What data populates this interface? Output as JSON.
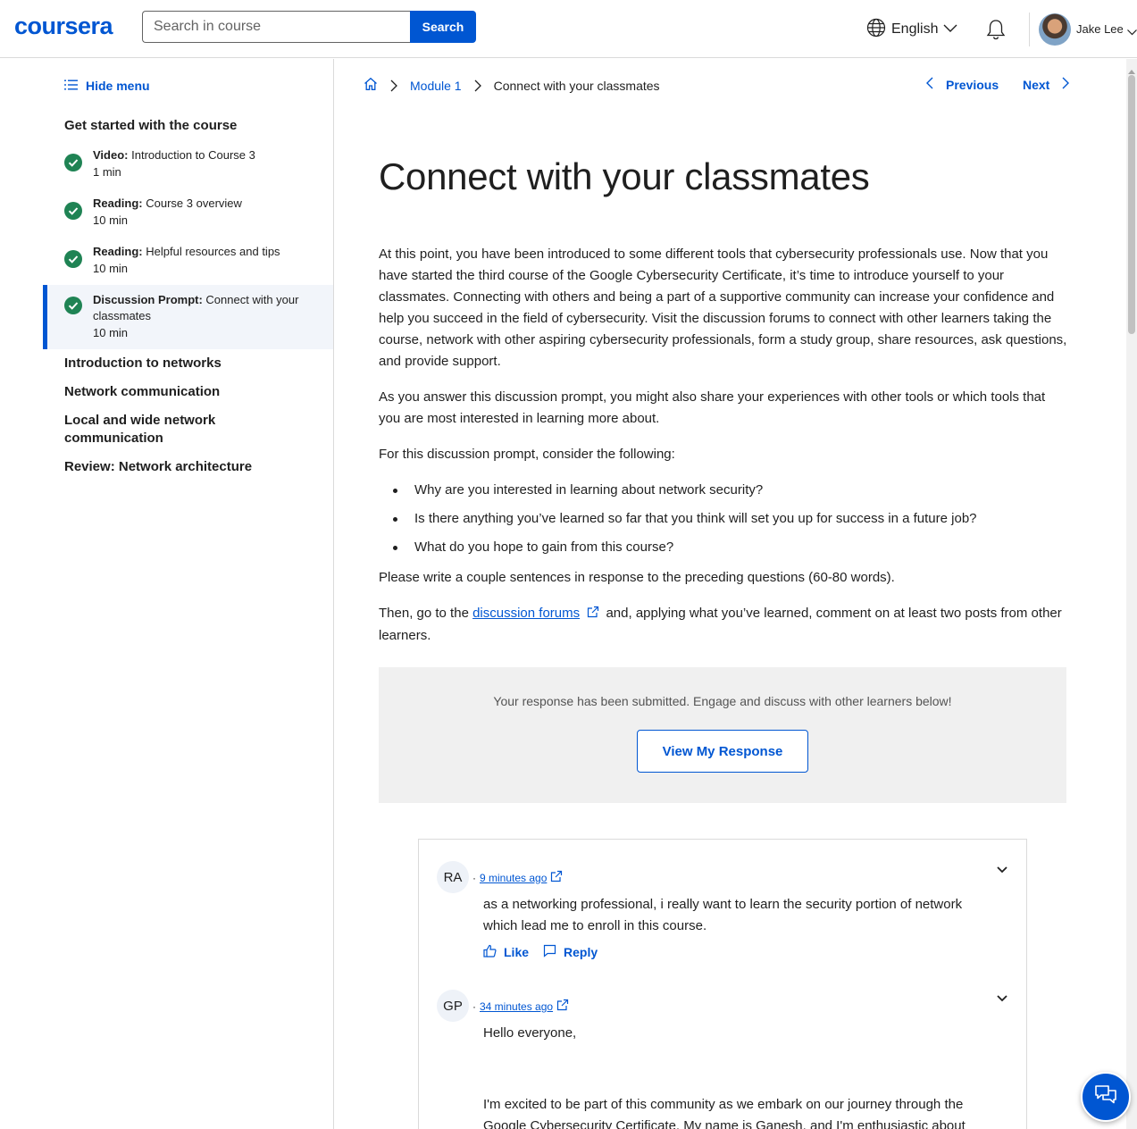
{
  "header": {
    "logo": "coursera",
    "search_placeholder": "Search in course",
    "search_button": "Search",
    "language": "English",
    "username": "Jake Lee",
    "icons": [
      "globe-icon",
      "chevron-down-icon",
      "bell-icon",
      "avatar"
    ]
  },
  "sidebar": {
    "hide_menu": "Hide menu",
    "lesson_title": "Get started with the course",
    "items": [
      {
        "type": "Video:",
        "title": "Introduction to Course 3",
        "duration": "1 min"
      },
      {
        "type": "Reading:",
        "title": "Course 3 overview",
        "duration": "10 min"
      },
      {
        "type": "Reading:",
        "title": "Helpful resources and tips",
        "duration": "10 min"
      },
      {
        "type": "Discussion Prompt:",
        "title": "Connect with your classmates",
        "duration": "10 min"
      }
    ],
    "sections": [
      "Introduction to networks",
      "Network communication",
      "Local and wide network communication",
      "Review: Network architecture"
    ]
  },
  "breadcrumb": {
    "module": "Module 1",
    "current": "Connect with your classmates"
  },
  "nav": {
    "previous": "Previous",
    "next": "Next"
  },
  "content": {
    "title": "Connect with your classmates",
    "p1": "At this point, you have been introduced to some different tools that cybersecurity professionals use. Now that you have started the third course of the Google Cybersecurity Certificate, it’s time to introduce yourself to your classmates. Connecting with others and being a part of a supportive community can increase your confidence and help you succeed in the field of cybersecurity. Visit the discussion forums to connect with other learners taking the course, network with other aspiring cybersecurity professionals, form a study group, share resources, ask questions, and provide support.",
    "p2": "As you answer this discussion prompt, you might also share your experiences with other tools or which tools that you are most interested in learning more about.",
    "p3": "For this discussion prompt, consider the following:",
    "bullets": [
      "Why are you interested in learning about network security?",
      "Is there anything you’ve learned so far that you think will set you up for success in a future job?",
      "What do you hope to gain from this course?"
    ],
    "p4": "Please write a couple sentences in response to the preceding questions (60-80 words).",
    "p5_before": "Then, go to the",
    "p5_link": "discussion forums",
    "p5_after": "and, applying what you’ve learned, comment on at least two posts from other learners."
  },
  "submission": {
    "message": "Your response has been submitted. Engage and discuss with other learners below!",
    "button": "View My Response"
  },
  "posts": [
    {
      "initials": "RA",
      "time": "9 minutes ago",
      "body": "as a networking professional, i really want to learn the security portion of network which lead me to enroll in this course.",
      "like": "Like",
      "reply": "Reply"
    },
    {
      "initials": "GP",
      "time": "34 minutes ago",
      "body1": "Hello everyone,",
      "body2": "I'm excited to be part of this community as we embark on our journey through the Google Cybersecurity Certificate. My name is Ganesh, and I'm enthusiastic about"
    }
  ],
  "colors": {
    "brand": "#0056d2",
    "complete": "#1f8354",
    "submitted_bg": "#f0f0f0"
  }
}
